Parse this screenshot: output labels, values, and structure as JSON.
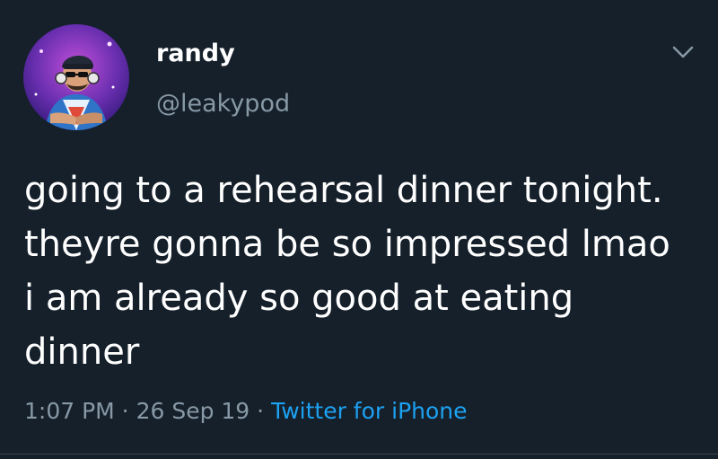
{
  "author": {
    "display_name": "randy",
    "handle": "@leakypod",
    "avatar_icon": "user-avatar-icon"
  },
  "tweet": {
    "lines": [
      "going to a rehearsal dinner tonight.",
      "theyre gonna be so impressed lmao",
      "i am already so good at eating",
      "dinner"
    ],
    "time": "1:07 PM",
    "separator": " · ",
    "date": "26 Sep 19",
    "source": "Twitter for iPhone"
  },
  "menu": {
    "icon": "chevron-down-icon"
  },
  "colors": {
    "background": "#15202b",
    "primary_text": "#ffffff",
    "secondary_text": "#8899a6",
    "accent": "#1da1f2"
  }
}
